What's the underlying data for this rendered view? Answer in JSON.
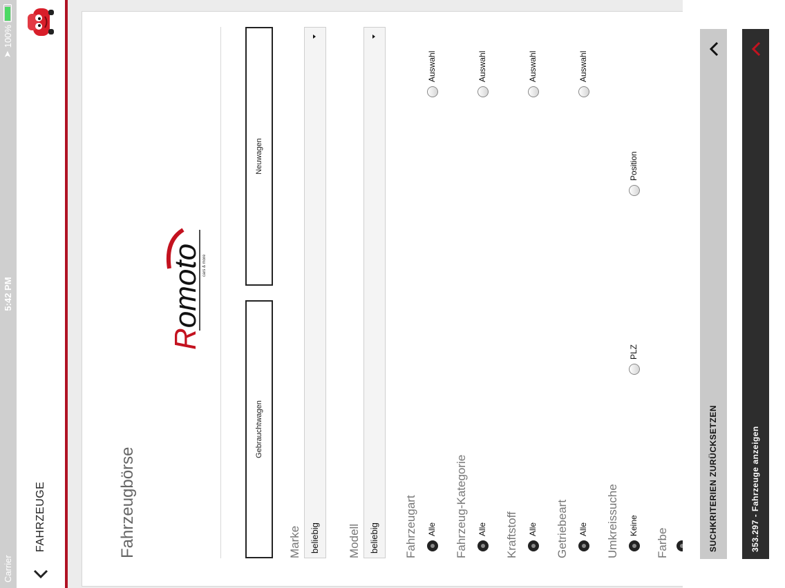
{
  "status_bar": {
    "carrier": "Carrier",
    "time": "5:42 PM",
    "battery": "100%"
  },
  "navbar": {
    "title": "FAHRZEUGE"
  },
  "form": {
    "title": "Fahrzeugbörse",
    "logo_text": "Romoto",
    "logo_tagline": "cars & more",
    "segments": [
      "Gebrauchtwagen",
      "Neuwagen"
    ],
    "marke": {
      "label": "Marke",
      "value": "beliebig"
    },
    "modell": {
      "label": "Modell",
      "value": "beliebig"
    },
    "fahrzeugart": {
      "label": "Fahrzeugart",
      "options": [
        "Alle",
        "Auswahl"
      ]
    },
    "kategorie": {
      "label": "Fahrzeug-Kategorie",
      "options": [
        "Alle",
        "Auswahl"
      ]
    },
    "kraftstoff": {
      "label": "Kraftstoff",
      "options": [
        "Alle",
        "Auswahl"
      ]
    },
    "getriebeart": {
      "label": "Getriebeart",
      "options": [
        "Alle",
        "Auswahl"
      ]
    },
    "umkreissuche": {
      "label": "Umkreissuche",
      "options": [
        "Keine",
        "PLZ",
        "Position"
      ]
    },
    "farbe": {
      "label": "Farbe"
    }
  },
  "buttons": {
    "reset": "SUCHKRITERIEN ZURÜCKSETZEN",
    "show": "353.297 - Fahrzeuge anzeigen"
  },
  "colors": {
    "accent": "#b01224",
    "dark_button": "#2d2d2d",
    "light_button": "#c9c9c9"
  }
}
